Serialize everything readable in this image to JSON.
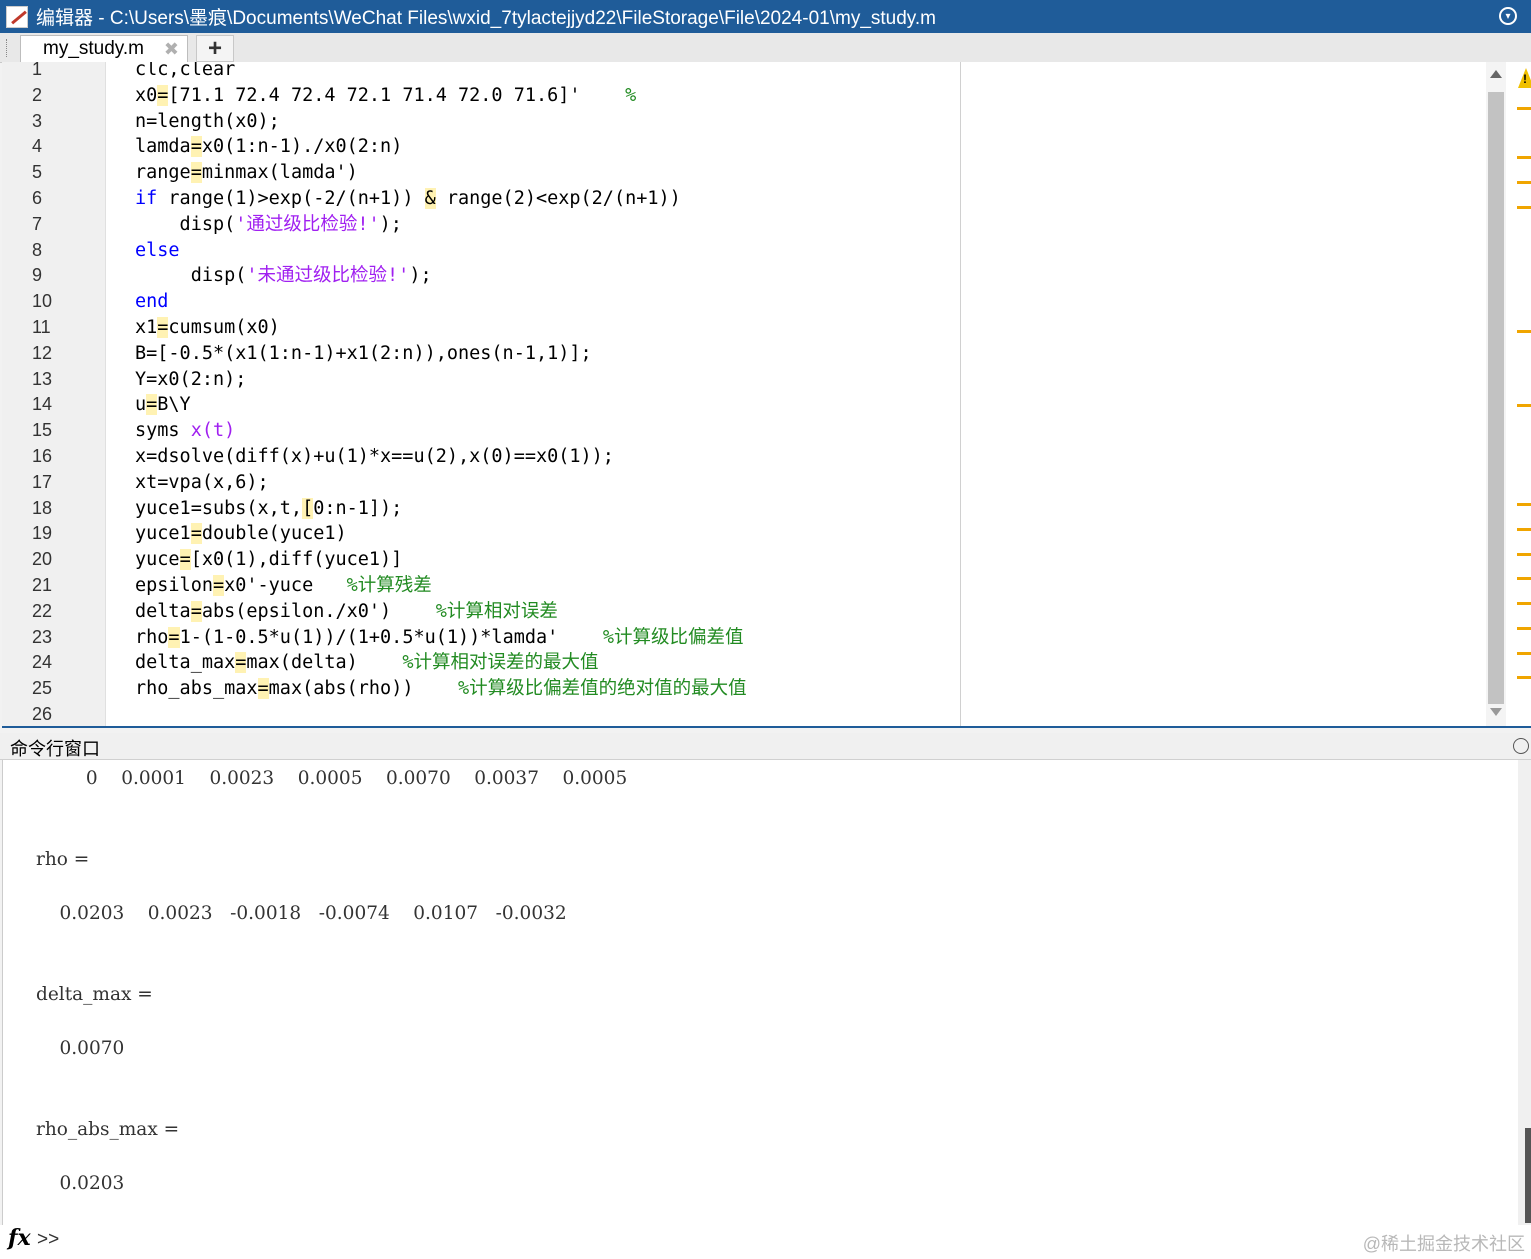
{
  "window": {
    "title": "编辑器 - C:\\Users\\墨痕\\Documents\\WeChat Files\\wxid_7tylactejjyd22\\FileStorage\\File\\2024-01\\my_study.m"
  },
  "tabs": [
    {
      "label": "my_study.m",
      "close": "✖"
    }
  ],
  "add_tab_label": "+",
  "editor": {
    "line_numbers": [
      "1",
      "2",
      "3",
      "4",
      "5",
      "6",
      "7",
      "8",
      "9",
      "10",
      "11",
      "12",
      "13",
      "14",
      "15",
      "16",
      "17",
      "18",
      "19",
      "20",
      "21",
      "22",
      "23",
      "24",
      "25",
      "26"
    ],
    "lines": [
      [
        {
          "t": "clc,clear"
        }
      ],
      [
        {
          "t": "x0"
        },
        {
          "t": "=",
          "c": "hl"
        },
        {
          "t": "[71.1 72.4 72.4 72.1 71.4 72.0 71.6]'    "
        },
        {
          "t": "%",
          "c": "cmt"
        }
      ],
      [
        {
          "t": "n=length(x0);"
        }
      ],
      [
        {
          "t": "lamda"
        },
        {
          "t": "=",
          "c": "hl"
        },
        {
          "t": "x0(1:n-1)./x0(2:n)"
        }
      ],
      [
        {
          "t": "range"
        },
        {
          "t": "=",
          "c": "hl"
        },
        {
          "t": "minmax(lamda')"
        }
      ],
      [
        {
          "t": "if",
          "c": "kw"
        },
        {
          "t": " range(1)>exp(-2/(n+1)) "
        },
        {
          "t": "&",
          "c": "hl"
        },
        {
          "t": " range(2)<exp(2/(n+1))"
        }
      ],
      [
        {
          "t": "    disp("
        },
        {
          "t": "'通过级比检验!'",
          "c": "str"
        },
        {
          "t": ");"
        }
      ],
      [
        {
          "t": "else",
          "c": "kw"
        }
      ],
      [
        {
          "t": "     disp("
        },
        {
          "t": "'未通过级比检验!'",
          "c": "str"
        },
        {
          "t": ");"
        }
      ],
      [
        {
          "t": "end",
          "c": "kw"
        }
      ],
      [
        {
          "t": "x1"
        },
        {
          "t": "=",
          "c": "hl"
        },
        {
          "t": "cumsum(x0)"
        }
      ],
      [
        {
          "t": "B=[-0.5*(x1(1:n-1)+x1(2:n)),ones(n-1,1)];"
        }
      ],
      [
        {
          "t": "Y=x0(2:n);"
        }
      ],
      [
        {
          "t": "u"
        },
        {
          "t": "=",
          "c": "hl"
        },
        {
          "t": "B\\Y"
        }
      ],
      [
        {
          "t": "syms "
        },
        {
          "t": "x(t)",
          "c": "str"
        }
      ],
      [
        {
          "t": "x=dsolve(diff(x)+u(1)*x==u(2),x(0)==x0(1));"
        }
      ],
      [
        {
          "t": "xt=vpa(x,6);"
        }
      ],
      [
        {
          "t": "yuce1=subs(x,t,"
        },
        {
          "t": "[",
          "c": "hl"
        },
        {
          "t": "0:n-1]);"
        }
      ],
      [
        {
          "t": "yuce1"
        },
        {
          "t": "=",
          "c": "hl"
        },
        {
          "t": "double(yuce1)"
        }
      ],
      [
        {
          "t": "yuce"
        },
        {
          "t": "=",
          "c": "hl"
        },
        {
          "t": "[x0(1),diff(yuce1)]"
        }
      ],
      [
        {
          "t": "epsilon"
        },
        {
          "t": "=",
          "c": "hl"
        },
        {
          "t": "x0'-yuce   "
        },
        {
          "t": "%计算残差",
          "c": "cmt"
        }
      ],
      [
        {
          "t": "delta"
        },
        {
          "t": "=",
          "c": "hl"
        },
        {
          "t": "abs(epsilon./x0')    "
        },
        {
          "t": "%计算相对误差",
          "c": "cmt"
        }
      ],
      [
        {
          "t": "rho"
        },
        {
          "t": "=",
          "c": "hl"
        },
        {
          "t": "1-(1-0.5*u(1))/(1+0.5*u(1))*lamda'    "
        },
        {
          "t": "%计算级比偏差值",
          "c": "cmt"
        }
      ],
      [
        {
          "t": "delta_max"
        },
        {
          "t": "=",
          "c": "hl"
        },
        {
          "t": "max(delta)    "
        },
        {
          "t": "%计算相对误差的最大值",
          "c": "cmt"
        }
      ],
      [
        {
          "t": "rho_abs_max"
        },
        {
          "t": "=",
          "c": "hl"
        },
        {
          "t": "max(abs(rho))    "
        },
        {
          "t": "%计算级比偏差值的绝对值的最大值",
          "c": "cmt"
        }
      ],
      [
        {
          "t": ""
        }
      ]
    ]
  },
  "command_window": {
    "title": "命令行窗口",
    "output_lines": [
      "         0    0.0001    0.0023    0.0005    0.0070    0.0037    0.0005",
      "rho =",
      "    0.0203    0.0023   -0.0018   -0.0074    0.0107   -0.0032",
      "delta_max =",
      "    0.0070",
      "rho_abs_max =",
      "    0.0203"
    ],
    "prompt_fx": "fx",
    "prompt": ">>"
  },
  "watermark": "@稀土掘金技术社区",
  "colors": {
    "titlebar": "#1f5c99",
    "keyword": "#0000ff",
    "string": "#a020f0",
    "comment": "#228b22",
    "warning_marker": "#f0a500"
  }
}
